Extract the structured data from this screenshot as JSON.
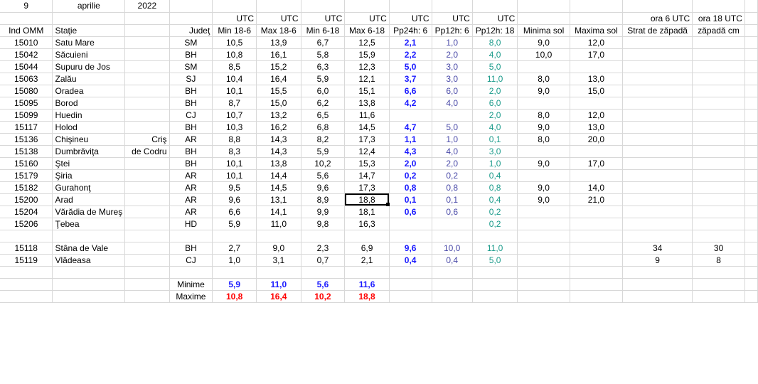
{
  "date": {
    "day": "9",
    "month": "aprilie",
    "year": "2022"
  },
  "utc_label": "UTC",
  "headers": {
    "ind": "Ind OMM",
    "statie": "Staţie",
    "judet": "Judeţ",
    "min18": "Min 18-6",
    "max18": "Max 18-6",
    "min6": "Min 6-18",
    "max6": "Max 6-18",
    "pp24": "Pp24h: 6",
    "pp12a": "Pp12h: 6",
    "pp12b": "Pp12h: 18",
    "minsol": "Minima sol",
    "maxsol": "Maxima sol",
    "ora6": "ora 6 UTC",
    "ora18": "ora 18 UTC",
    "strat": "Strat de zăpadă",
    "zapada": "zăpadă cm"
  },
  "rows": [
    {
      "ind": "15010",
      "statie": "Satu Mare",
      "extra": "",
      "judet": "SM",
      "min18": "10,5",
      "max18": "13,9",
      "min6": "6,7",
      "max6": "12,5",
      "pp24": "2,1",
      "pp12a": "1,0",
      "pp12b": "8,0",
      "minsol": "9,0",
      "maxsol": "12,0",
      "strat": "",
      "zapada": ""
    },
    {
      "ind": "15042",
      "statie": "Săcuieni",
      "extra": "",
      "judet": "BH",
      "min18": "10,8",
      "max18": "16,1",
      "min6": "5,8",
      "max6": "15,9",
      "pp24": "2,2",
      "pp12a": "2,0",
      "pp12b": "4,0",
      "minsol": "10,0",
      "maxsol": "17,0",
      "strat": "",
      "zapada": ""
    },
    {
      "ind": "15044",
      "statie": "Supuru de Jos",
      "extra": "",
      "judet": "SM",
      "min18": "8,5",
      "max18": "15,2",
      "min6": "6,3",
      "max6": "12,3",
      "pp24": "5,0",
      "pp12a": "3,0",
      "pp12b": "5,0",
      "minsol": "",
      "maxsol": "",
      "strat": "",
      "zapada": ""
    },
    {
      "ind": "15063",
      "statie": "Zalău",
      "extra": "",
      "judet": "SJ",
      "min18": "10,4",
      "max18": "16,4",
      "min6": "5,9",
      "max6": "12,1",
      "pp24": "3,7",
      "pp12a": "3,0",
      "pp12b": "11,0",
      "minsol": "8,0",
      "maxsol": "13,0",
      "strat": "",
      "zapada": ""
    },
    {
      "ind": "15080",
      "statie": "Oradea",
      "extra": "",
      "judet": "BH",
      "min18": "10,1",
      "max18": "15,5",
      "min6": "6,0",
      "max6": "15,1",
      "pp24": "6,6",
      "pp12a": "6,0",
      "pp12b": "2,0",
      "minsol": "9,0",
      "maxsol": "15,0",
      "strat": "",
      "zapada": ""
    },
    {
      "ind": "15095",
      "statie": "Borod",
      "extra": "",
      "judet": "BH",
      "min18": "8,7",
      "max18": "15,0",
      "min6": "6,2",
      "max6": "13,8",
      "pp24": "4,2",
      "pp12a": "4,0",
      "pp12b": "6,0",
      "minsol": "",
      "maxsol": "",
      "strat": "",
      "zapada": ""
    },
    {
      "ind": "15099",
      "statie": "Huedin",
      "extra": "",
      "judet": "CJ",
      "min18": "10,7",
      "max18": "13,2",
      "min6": "6,5",
      "max6": "11,6",
      "pp24": "",
      "pp12a": "",
      "pp12b": "2,0",
      "minsol": "8,0",
      "maxsol": "12,0",
      "strat": "",
      "zapada": ""
    },
    {
      "ind": "15117",
      "statie": "Holod",
      "extra": "",
      "judet": "BH",
      "min18": "10,3",
      "max18": "16,2",
      "min6": "6,8",
      "max6": "14,5",
      "pp24": "4,7",
      "pp12a": "5,0",
      "pp12b": "4,0",
      "minsol": "9,0",
      "maxsol": "13,0",
      "strat": "",
      "zapada": ""
    },
    {
      "ind": "15136",
      "statie": "Chişineu",
      "extra": "Criş",
      "judet": "AR",
      "min18": "8,8",
      "max18": "14,3",
      "min6": "8,2",
      "max6": "17,3",
      "pp24": "1,1",
      "pp12a": "1,0",
      "pp12b": "0,1",
      "minsol": "8,0",
      "maxsol": "20,0",
      "strat": "",
      "zapada": ""
    },
    {
      "ind": "15138",
      "statie": "Dumbrăviţa",
      "extra": "de Codru",
      "judet": "BH",
      "min18": "8,3",
      "max18": "14,3",
      "min6": "5,9",
      "max6": "12,4",
      "pp24": "4,3",
      "pp12a": "4,0",
      "pp12b": "3,0",
      "minsol": "",
      "maxsol": "",
      "strat": "",
      "zapada": ""
    },
    {
      "ind": "15160",
      "statie": "Ştei",
      "extra": "",
      "judet": "BH",
      "min18": "10,1",
      "max18": "13,8",
      "min6": "10,2",
      "max6": "15,3",
      "pp24": "2,0",
      "pp12a": "2,0",
      "pp12b": "1,0",
      "minsol": "9,0",
      "maxsol": "17,0",
      "strat": "",
      "zapada": ""
    },
    {
      "ind": "15179",
      "statie": "Şiria",
      "extra": "",
      "judet": "AR",
      "min18": "10,1",
      "max18": "14,4",
      "min6": "5,6",
      "max6": "14,7",
      "pp24": "0,2",
      "pp12a": "0,2",
      "pp12b": "0,4",
      "minsol": "",
      "maxsol": "",
      "strat": "",
      "zapada": ""
    },
    {
      "ind": "15182",
      "statie": "Gurahonţ",
      "extra": "",
      "judet": "AR",
      "min18": "9,5",
      "max18": "14,5",
      "min6": "9,6",
      "max6": "17,3",
      "pp24": "0,8",
      "pp12a": "0,8",
      "pp12b": "0,8",
      "minsol": "9,0",
      "maxsol": "14,0",
      "strat": "",
      "zapada": ""
    },
    {
      "ind": "15200",
      "statie": "Arad",
      "extra": "",
      "judet": "AR",
      "min18": "9,6",
      "max18": "13,1",
      "min6": "8,9",
      "max6": "18,8",
      "pp24": "0,1",
      "pp12a": "0,1",
      "pp12b": "0,4",
      "minsol": "9,0",
      "maxsol": "21,0",
      "strat": "",
      "zapada": ""
    },
    {
      "ind": "15204",
      "statie": "Vărădia de Mureş",
      "extra": "",
      "judet": "AR",
      "min18": "6,6",
      "max18": "14,1",
      "min6": "9,9",
      "max6": "18,1",
      "pp24": "0,6",
      "pp12a": "0,6",
      "pp12b": "0,2",
      "minsol": "",
      "maxsol": "",
      "strat": "",
      "zapada": ""
    },
    {
      "ind": "15206",
      "statie": "Ţebea",
      "extra": "",
      "judet": "HD",
      "min18": "5,9",
      "max18": "11,0",
      "min6": "9,8",
      "max6": "16,3",
      "pp24": "",
      "pp12a": "",
      "pp12b": "0,2",
      "minsol": "",
      "maxsol": "",
      "strat": "",
      "zapada": ""
    },
    {
      "ind": "",
      "statie": "",
      "extra": "",
      "judet": "",
      "min18": "",
      "max18": "",
      "min6": "",
      "max6": "",
      "pp24": "",
      "pp12a": "",
      "pp12b": "",
      "minsol": "",
      "maxsol": "",
      "strat": "",
      "zapada": ""
    },
    {
      "ind": "15118",
      "statie": "Stâna de Vale",
      "extra": "",
      "judet": "BH",
      "min18": "2,7",
      "max18": "9,0",
      "min6": "2,3",
      "max6": "6,9",
      "pp24": "9,6",
      "pp12a": "10,0",
      "pp12b": "11,0",
      "minsol": "",
      "maxsol": "",
      "strat": "34",
      "zapada": "30"
    },
    {
      "ind": "15119",
      "statie": "Vlădeasa",
      "extra": "",
      "judet": "CJ",
      "min18": "1,0",
      "max18": "3,1",
      "min6": "0,7",
      "max6": "2,1",
      "pp24": "0,4",
      "pp12a": "0,4",
      "pp12b": "5,0",
      "minsol": "",
      "maxsol": "",
      "strat": "9",
      "zapada": "8"
    }
  ],
  "summary": {
    "minime": {
      "label": "Minime",
      "min18": "5,9",
      "max18": "11,0",
      "min6": "5,6",
      "max6": "11,6"
    },
    "maxime": {
      "label": "Maxime",
      "min18": "10,8",
      "max18": "16,4",
      "min6": "10,2",
      "max6": "18,8"
    }
  },
  "colors": {
    "pp24": "#1a1aff",
    "pp12a": "#4a4aa8",
    "pp12b": "#1a9a8a",
    "min": "#1a1aff",
    "max": "#ff0000",
    "grid": "#d8d8d8"
  }
}
